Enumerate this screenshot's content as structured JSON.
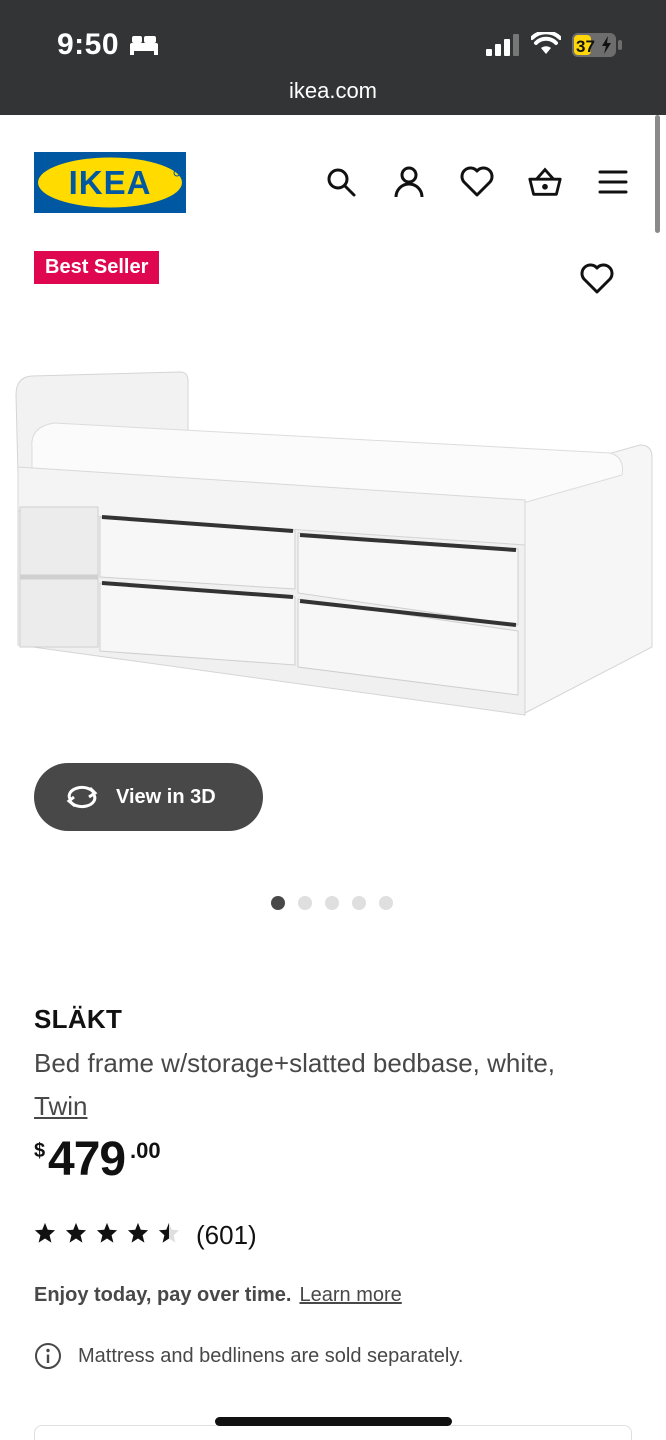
{
  "status_bar": {
    "time": "9:50",
    "battery": "37"
  },
  "browser": {
    "url": "ikea.com"
  },
  "header": {
    "logo_text": "IKEA",
    "brand_colors": {
      "blue": "#0058a3",
      "yellow": "#ffdb00"
    },
    "icons": [
      "search-icon",
      "account-icon",
      "heart-icon",
      "basket-icon",
      "menu-icon"
    ]
  },
  "product": {
    "badge": "Best Seller",
    "badge_color": "#e00751",
    "view_3d_label": "View in 3D",
    "gallery": {
      "count": 5,
      "active_index": 0
    },
    "name": "SLÄKT",
    "description": "Bed frame w/storage+slatted bedbase, white,",
    "size": "Twin",
    "price": {
      "currency": "$",
      "integer": "479",
      "decimal": ".00"
    },
    "rating": {
      "value": 4.5,
      "max": 5,
      "reviews": "(601)"
    },
    "financing": {
      "text": "Enjoy today, pay over time.",
      "link": "Learn more"
    },
    "notice": "Mattress and bedlinens are sold separately."
  }
}
